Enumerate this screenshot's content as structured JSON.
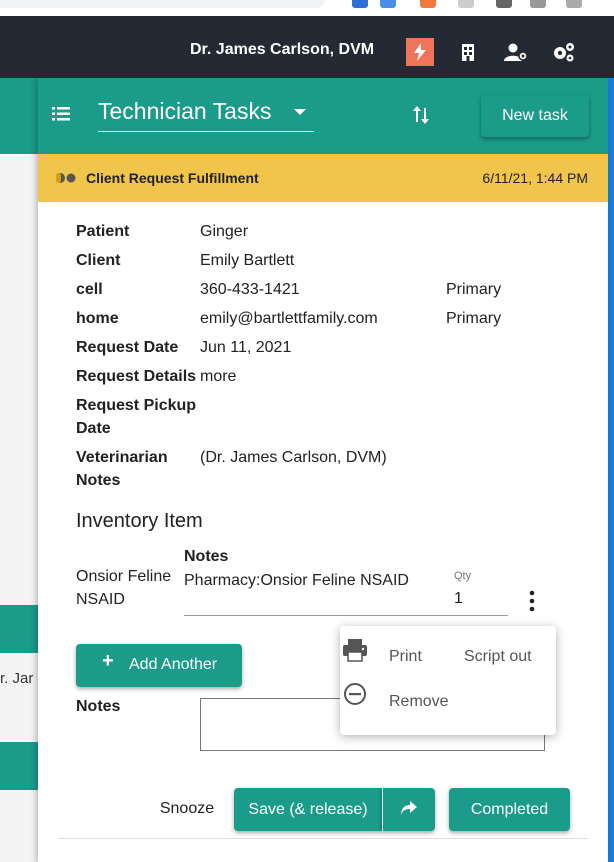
{
  "colors": {
    "teal": "#1b9b8a",
    "header_dark": "#242a33",
    "banner_yellow": "#f0c549",
    "flash_orange": "#f0735c"
  },
  "header": {
    "user_name": "Dr. James Carlson, DVM",
    "icons": [
      "flash-icon",
      "building-icon",
      "user-settings-icon",
      "gears-icon"
    ]
  },
  "background_page": {
    "row_text": "r. Jar"
  },
  "panel": {
    "menu_icon": "hamburger-list-icon",
    "task_type": "Technician Tasks",
    "sort_icon": "sort-icon",
    "new_task_label": "New task",
    "banner": {
      "icon": "pill-icon",
      "title": "Client Request Fulfillment",
      "timestamp": "6/11/21, 1:44 PM"
    },
    "fields": {
      "patient": {
        "label": "Patient",
        "value": "Ginger"
      },
      "client": {
        "label": "Client",
        "value": "Emily Bartlett"
      },
      "cell": {
        "label": "cell",
        "value": "360-433-1421",
        "extra": "Primary"
      },
      "home": {
        "label": "home",
        "value": "emily@bartlettfamily.com",
        "extra": "Primary"
      },
      "request_date": {
        "label": "Request Date",
        "value": "Jun 11, 2021"
      },
      "request_details": {
        "label": "Request Details",
        "value": "more"
      },
      "pickup_date": {
        "label_line1": "Request Pickup",
        "label_line2": "Date",
        "value": ""
      },
      "vet_notes": {
        "label_line1": "Veterinarian",
        "label_line2": "Notes",
        "value": "(Dr. James Carlson, DVM)"
      }
    },
    "inventory": {
      "section_title": "Inventory Item",
      "item_name_line1": "Onsior Feline",
      "item_name_line2": "NSAID",
      "notes_label": "Notes",
      "notes_value": "Pharmacy:Onsior Feline NSAID",
      "qty_label": "Qty",
      "qty_value": "1"
    },
    "add_another_label": "Add Another",
    "notes_label": "Notes",
    "notes_value": "",
    "popup": {
      "print_label": "Print",
      "script_out_label": "Script out",
      "remove_label": "Remove"
    },
    "footer": {
      "snooze_label": "Snooze",
      "save_label": "Save (& release)",
      "completed_label": "Completed"
    }
  }
}
